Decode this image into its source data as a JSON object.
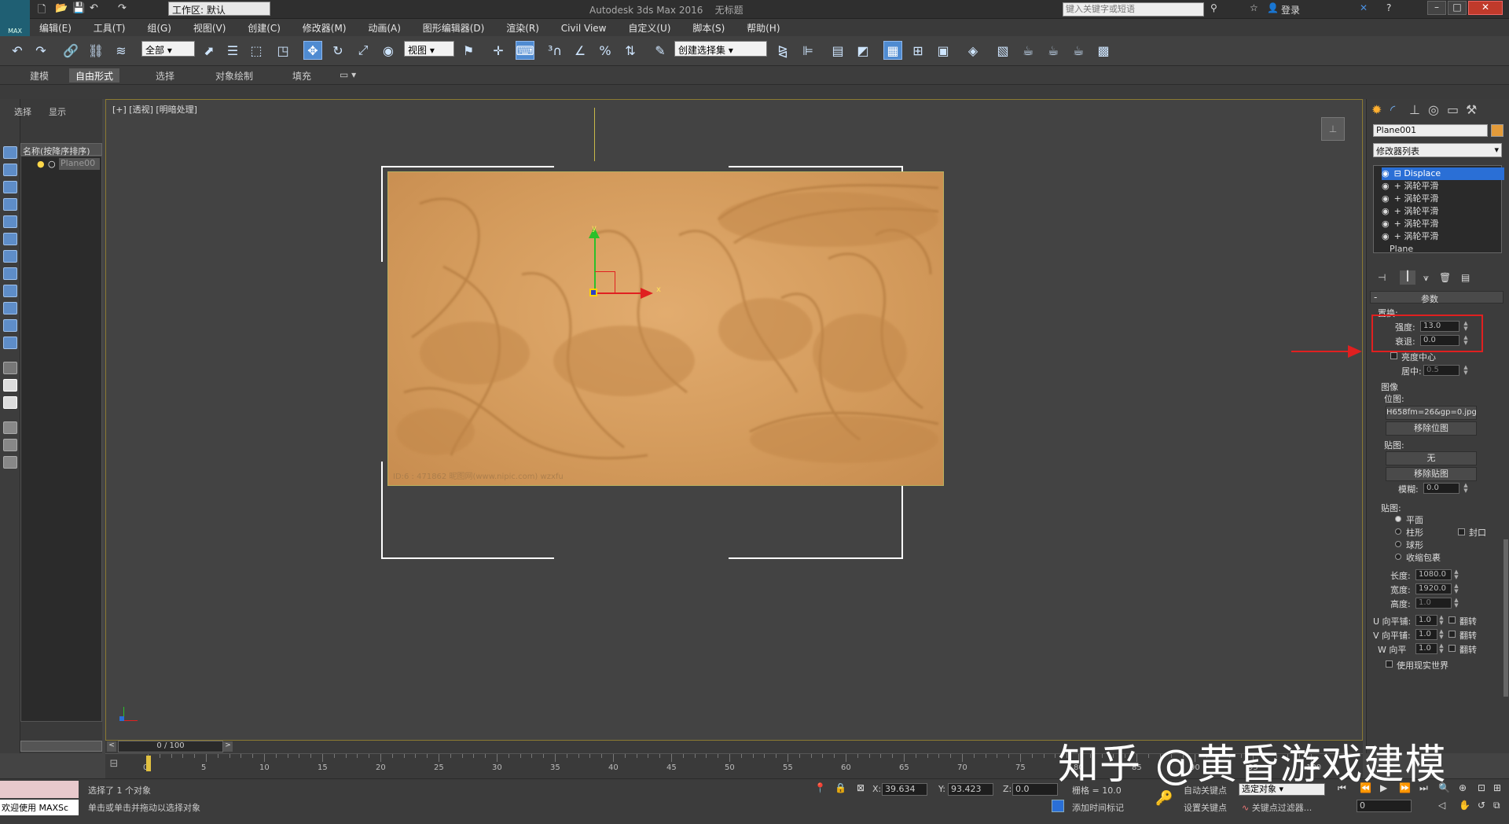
{
  "title": {
    "app": "Autodesk 3ds Max 2016",
    "doc": "无标题",
    "workspace": "工作区: 默认",
    "search_placeholder": "键入关键字或短语",
    "login": "登录"
  },
  "logo": "MAX",
  "menu": [
    "编辑(E)",
    "工具(T)",
    "组(G)",
    "视图(V)",
    "创建(C)",
    "修改器(M)",
    "动画(A)",
    "图形编辑器(D)",
    "渲染(R)",
    "Civil View",
    "自定义(U)",
    "脚本(S)",
    "帮助(H)"
  ],
  "toolbar": {
    "filter": "全部",
    "refcoord": "视图",
    "selset": "创建选择集"
  },
  "ribbon": {
    "tabs": [
      "建模",
      "自由形式",
      "选择",
      "对象绘制",
      "填充"
    ],
    "active": 1
  },
  "scene": {
    "tabs": [
      "选择",
      "显示"
    ],
    "col_header": "名称(按降序排序)",
    "item": "Plane00"
  },
  "viewport": {
    "label": "[+] [透视] [明暗处理]",
    "relief_text": "ID:6 : 471862  昵图网(www.nipic.com)  wzxfu"
  },
  "rpanel": {
    "objname": "Plane001",
    "modlist": "修改器列表",
    "stack": [
      "Displace",
      "涡轮平滑",
      "涡轮平滑",
      "涡轮平滑",
      "涡轮平滑",
      "涡轮平滑",
      "Plane"
    ],
    "params": "参数",
    "displace_group": "置换:",
    "strength_label": "强度:",
    "strength": "13.0",
    "decay_label": "衰退:",
    "decay": "0.0",
    "lumcenter": "亮度中心",
    "center_label": "居中:",
    "center": "0.5",
    "image_group": "图像",
    "bitmap_label": "位图:",
    "bitmap_value": "H658fm=26&gp=0.jpg",
    "remove_bitmap": "移除位图",
    "map_label": "贴图:",
    "map_none": "无",
    "remove_map": "移除贴图",
    "blur_label": "模糊:",
    "blur": "0.0",
    "mapping_group": "贴图:",
    "mapping": [
      "平面",
      "柱形",
      "球形",
      "收缩包裹"
    ],
    "cap": "封口",
    "length_label": "长度:",
    "length": "1080.0",
    "width_label": "宽度:",
    "width": "1920.0",
    "height_label": "高度:",
    "height": "1.0",
    "utile_label": "U 向平铺:",
    "utile": "1.0",
    "vtile_label": "V 向平铺:",
    "vtile": "1.0",
    "wtile_label": "W 向平",
    "wtile": "1.0",
    "flip": "翻转",
    "realworld": "使用现实世界"
  },
  "timeline": {
    "frame": "0 / 100",
    "ticks": [
      "0",
      "5",
      "10",
      "15",
      "20",
      "25",
      "30",
      "35",
      "40",
      "45",
      "50",
      "55",
      "60",
      "65",
      "70",
      "75",
      "80",
      "85",
      "90",
      "95",
      "100"
    ]
  },
  "status": {
    "welcome": "欢迎使用 MAXSc",
    "selected": "选择了 1 个对象",
    "hint": "单击或单击并拖动以选择对象",
    "x_label": "X:",
    "x": "39.634",
    "y_label": "Y:",
    "y": "93.423",
    "z_label": "Z:",
    "z": "0.0",
    "grid": "栅格 = 10.0",
    "addtime": "添加时间标记",
    "autokey": "自动关键点",
    "setkey": "设置关键点",
    "selobj": "选定对象",
    "keyfilter": "关键点过滤器...",
    "frame": "0"
  },
  "watermark": "知乎 @黄昏游戏建模",
  "colors": {
    "accent": "#4f8bd1",
    "highlight_red": "#e02020",
    "relief": "#d39a5b",
    "selection_blue": "#2a6fd6"
  }
}
